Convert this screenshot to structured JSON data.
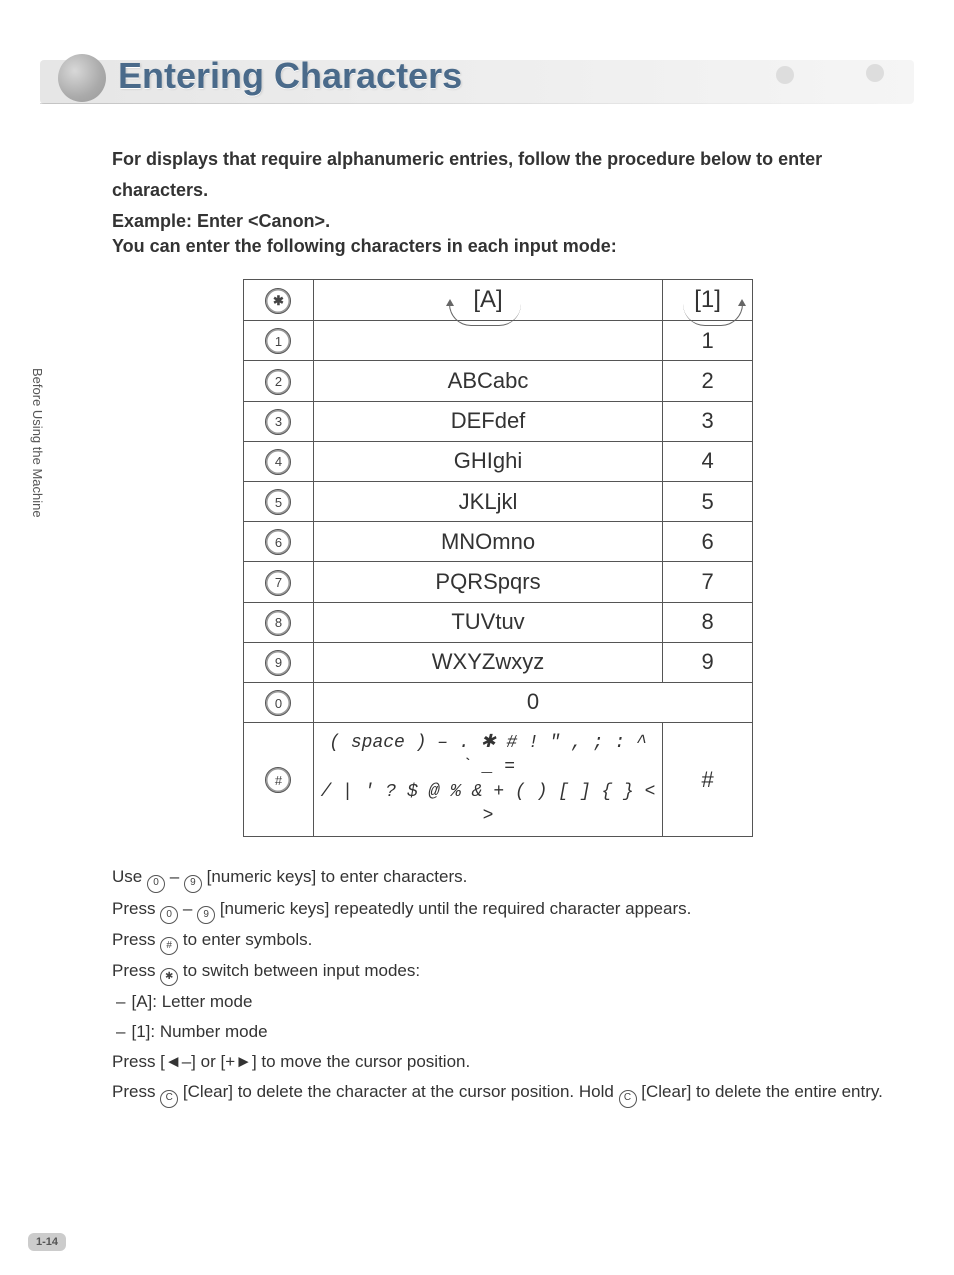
{
  "sidebar": {
    "label": "Before Using the Machine"
  },
  "page_number": "1-14",
  "header": {
    "title": "Entering Characters"
  },
  "intro": {
    "line1": "For displays that require alphanumeric entries, follow the procedure below to enter",
    "line2": "characters.",
    "example": "Example: Enter <Canon>.",
    "modes_intro": "You can enter the following characters in each input mode:"
  },
  "table": {
    "mode_a": "[A]",
    "mode_1": "[1]",
    "star": "✱",
    "hash": "#",
    "rows": [
      {
        "key": "1",
        "chars": "",
        "num": "1"
      },
      {
        "key": "2",
        "chars": "ABCabc",
        "num": "2"
      },
      {
        "key": "3",
        "chars": "DEFdef",
        "num": "3"
      },
      {
        "key": "4",
        "chars": "GHIghi",
        "num": "4"
      },
      {
        "key": "5",
        "chars": "JKLjkl",
        "num": "5"
      },
      {
        "key": "6",
        "chars": "MNOmno",
        "num": "6"
      },
      {
        "key": "7",
        "chars": "PQRSpqrs",
        "num": "7"
      },
      {
        "key": "8",
        "chars": "TUVtuv",
        "num": "8"
      },
      {
        "key": "9",
        "chars": "WXYZwxyz",
        "num": "9"
      }
    ],
    "zero_key": "0",
    "zero_chars": "0",
    "sym_key": "#",
    "sym_line1": "( space ) – . ✱ # ! \" , ; : ^ ` _ =",
    "sym_line2": "/ | ' ? $ @ % & + ( ) [ ] { } < >",
    "sym_num": "#"
  },
  "instructions": {
    "l1a": "Use ",
    "l1b": " – ",
    "l1c": " [numeric keys] to enter characters.",
    "l2a": "Press ",
    "l2b": " – ",
    "l2c": " [numeric keys] repeatedly until the required character appears.",
    "l3a": "Press ",
    "l3b": " to enter symbols.",
    "l4a": "Press ",
    "l4b": " to switch between input modes:",
    "l5": "[A]: Letter mode",
    "l6": "[1]: Number mode",
    "l7": "Press [◄–] or [+►] to move the cursor position.",
    "l8a": "Press ",
    "l8b": " [Clear] to delete the character at the cursor position. Hold ",
    "l8c": " [Clear] to delete the entire entry.",
    "key0": "0",
    "key9": "9",
    "keyhash": "#",
    "keystar": "✱",
    "keyC": "C"
  }
}
